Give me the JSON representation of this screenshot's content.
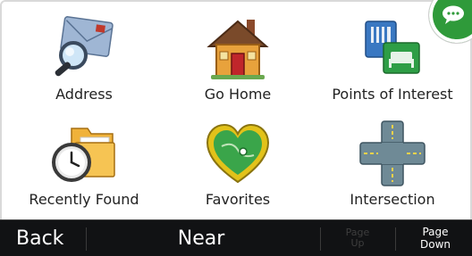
{
  "menu": {
    "items": [
      {
        "label": "Address",
        "icon": "address-envelope-magnifier-icon"
      },
      {
        "label": "Go Home",
        "icon": "house-icon"
      },
      {
        "label": "Points of Interest",
        "icon": "poi-map-icon"
      },
      {
        "label": "Recently Found",
        "icon": "clock-folder-icon"
      },
      {
        "label": "Favorites",
        "icon": "heart-icon"
      },
      {
        "label": "Intersection",
        "icon": "road-intersection-icon"
      }
    ]
  },
  "bottom_bar": {
    "back_label": "Back",
    "near_label": "Near",
    "page_up_line1": "Page",
    "page_up_line2": "Up",
    "page_down_line1": "Page",
    "page_down_line2": "Down"
  },
  "colors": {
    "bar_background": "#111214",
    "disabled_text": "#3e3e3e",
    "bubble_green": "#2f9a3a"
  }
}
